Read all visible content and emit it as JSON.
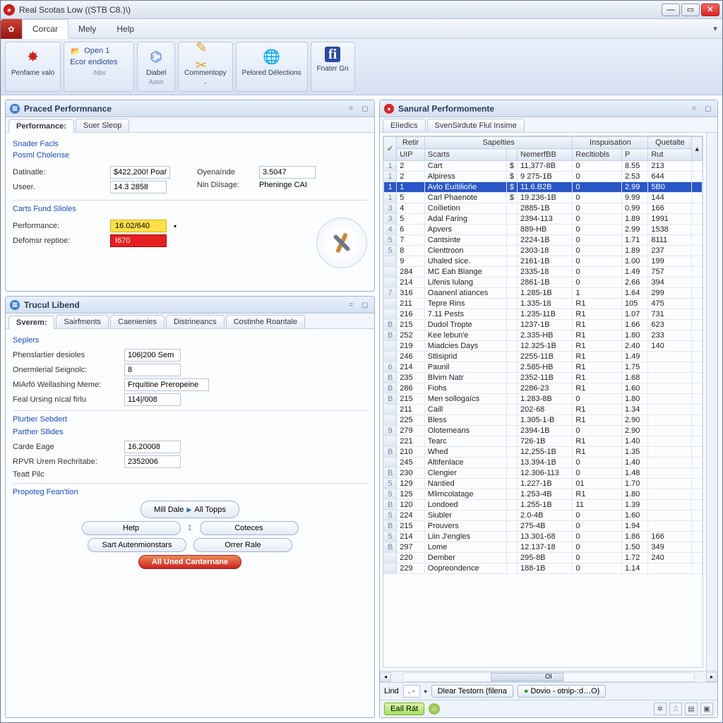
{
  "window": {
    "title": "Real Scotas Low ((STB C8.)\\)"
  },
  "menu": {
    "tabs": [
      "Corcar",
      "Mely",
      "Help"
    ],
    "active": 0
  },
  "ribbon": {
    "penfame": "Penfame valo",
    "open": {
      "open1": "Open 1",
      "endiotes": "Ecor endiotes",
      "nbs": "⁝Nbs"
    },
    "diabel": {
      "label": "Diabel",
      "sub": "Aoon"
    },
    "commentopy": {
      "label": "Commentopy",
      "sub": ""
    },
    "pelored": {
      "label": "Pelored Délections"
    },
    "fnater": {
      "label": "Fnater Gn"
    }
  },
  "panel1": {
    "title": "Praced Performnance",
    "tabs": [
      "Performance:",
      "Suer Sleop"
    ],
    "snader": "Snader Facls",
    "posml": "Posml Cholense",
    "datinatle_lbl": "Datinatle:",
    "datinatle_val": "$422,200! Poaŕ",
    "oyenaide_lbl": "Oyenaínde",
    "oyenaide_val": "3.5047",
    "useer_lbl": "Useer.",
    "useer_val": "14.3 2858",
    "ndisage_lbl": "Nin Diísage:",
    "ndisage_val": "Pheninge CAI",
    "carts": "Carts Fund Slioles",
    "perf_lbl": "Performance:",
    "perf_val": "16.02/640",
    "def_lbl": "Defomsr reptioe:",
    "def_val": "I670"
  },
  "panel2": {
    "title": "Trucul Libend",
    "tabs": [
      "Sverem:",
      "Sairfments",
      "Caenienies",
      "Distrineancs",
      "Costinhe Roantale"
    ],
    "seplers": "Seplers",
    "row1_lbl": "Phenslartier desioles",
    "row1_val": "106|200 Sem",
    "row2_lbl": "Onermlerial Seignolc:",
    "row2_val": "8",
    "row3_lbl": "MiArfó Wellashing Meme:",
    "row3_val": "Frquítine Preropeine",
    "row4_lbl": "Feal Ursing nícal fírlu",
    "row4_val": "114|/008",
    "plurber": "Plurber Sebdert",
    "partner": "Parther Sllides",
    "carde_lbl": "Carde Eage",
    "carde_val": "16,20008",
    "rpvr_lbl": "RPVR Urem Rechritabe:",
    "rpvr_val": "2352006",
    "teatt": "Teatt Pilc",
    "propoteg": "Propoteg Fean'tion",
    "btn_milldate": "Mill Dale",
    "btn_alltops": "All Topps",
    "btn_help": "Hetp",
    "btn_coteces": "Coteces",
    "btn_sart": "Sart Autenmionstars",
    "btn_orrer": "Orrer Rale",
    "btn_all": "All Uned Canternane"
  },
  "panel3": {
    "title": "Sanural Performomente",
    "tabs": [
      "Elíedics",
      "SvenSirdute Flul Insime"
    ],
    "header_super": [
      "Retir",
      "Sapelties",
      "Inspuisation",
      "Quetalte"
    ],
    "header": [
      "UIP",
      "Scarts",
      "NemerfBB",
      "Recltiobls",
      "P",
      "Rut"
    ],
    "rows": [
      {
        "n": "1",
        "u": "2",
        "s": "Cart",
        "d": "$",
        "nb": "11,377-8B",
        "r": "0",
        "p": "8.55",
        "rt": "213"
      },
      {
        "n": "1",
        "u": "2",
        "s": "Alpiress",
        "d": "$",
        "nb": "9 275-1B",
        "r": "0",
        "p": "2.53",
        "rt": "644"
      },
      {
        "n": "1",
        "u": "1",
        "s": "Avlo Euítilioňe",
        "d": "$",
        "nb": "11.6.B2B",
        "r": "0",
        "p": "2.99",
        "rt": "5B0",
        "sel": true
      },
      {
        "n": "1",
        "u": "5",
        "s": "Carl Phaenote",
        "d": "$",
        "nb": "19.236-1B",
        "r": "0",
        "p": "9.99",
        "rt": "144"
      },
      {
        "n": "3",
        "u": "4",
        "s": "Coílietion",
        "d": "",
        "nb": "2885-1B",
        "r": "0",
        "p": "0.99",
        "rt": "166"
      },
      {
        "n": "3",
        "u": "5",
        "s": "Adal Faring",
        "d": "",
        "nb": "2394-113",
        "r": "0",
        "p": "1.89",
        "rt": "1991"
      },
      {
        "n": "4",
        "u": "6",
        "s": "Apvers",
        "d": "",
        "nb": "889-HB",
        "r": "0",
        "p": "2.99",
        "rt": "1538"
      },
      {
        "n": "5",
        "u": "7",
        "s": "Cantsinte",
        "d": "",
        "nb": "2224-1B",
        "r": "0",
        "p": "1.71",
        "rt": "8111"
      },
      {
        "n": "5",
        "u": "8",
        "s": "Clenttroon",
        "d": "",
        "nb": "2303-18",
        "r": "0",
        "p": "1.89",
        "rt": "237"
      },
      {
        "n": "",
        "u": "9",
        "s": "Uhaled sice.",
        "d": "",
        "nb": "2161-1B",
        "r": "0",
        "p": "1.00",
        "rt": "199"
      },
      {
        "n": "",
        "u": "284",
        "s": "MC Eah Blange",
        "d": "",
        "nb": "2335-18",
        "r": "0",
        "p": "1.49",
        "rt": "757"
      },
      {
        "n": "",
        "u": "214",
        "s": "Lifenis lulang",
        "d": "",
        "nb": "2861-1B",
        "r": "0",
        "p": "2.66",
        "rt": "394"
      },
      {
        "n": "7",
        "u": "316",
        "s": "Oaanenl atiances",
        "d": "",
        "nb": "1.285-1B",
        "r": "1",
        "p": "1.64",
        "rt": "299"
      },
      {
        "n": "",
        "u": "211",
        "s": "Tepre Rins",
        "d": "",
        "nb": "1.335-18",
        "r": "R1",
        "p": "105",
        "rt": "475"
      },
      {
        "n": "",
        "u": "216",
        "s": "7.11 Pests",
        "d": "",
        "nb": "1.235-11B",
        "r": "R1",
        "p": "1.07",
        "rt": "731"
      },
      {
        "n": "B",
        "u": "215",
        "s": "Dudol Tropte",
        "d": "",
        "nb": "1237-1B",
        "r": "R1",
        "p": "1.66",
        "rt": "623"
      },
      {
        "n": "B",
        "u": "252",
        "s": "Kee lebun'e",
        "d": "",
        "nb": "2.335-HB",
        "r": "R1",
        "p": "1.80",
        "rt": "233"
      },
      {
        "n": "",
        "u": "219",
        "s": "Miadcies Days",
        "d": "",
        "nb": "12.325-1B",
        "r": "R1",
        "p": "2.40",
        "rt": "140"
      },
      {
        "n": "",
        "u": "246",
        "s": "Stlisiprid",
        "d": "",
        "nb": "2255-11B",
        "r": "R1",
        "p": "1.49",
        "rt": ""
      },
      {
        "n": "6",
        "u": "214",
        "s": "Paunil",
        "d": "",
        "nb": "2.585-HB",
        "r": "R1",
        "p": "1.75",
        "rt": ""
      },
      {
        "n": "B",
        "u": "235",
        "s": "Blvim Natr",
        "d": "",
        "nb": "2352-11B",
        "r": "R1",
        "p": "1.68",
        "rt": ""
      },
      {
        "n": "B",
        "u": "286",
        "s": "Fiohs",
        "d": "",
        "nb": "2286-23",
        "r": "R1",
        "p": "1.60",
        "rt": ""
      },
      {
        "n": "B",
        "u": "215",
        "s": "Men sollogaícs",
        "d": "",
        "nb": "1.283-8B",
        "r": "0",
        "p": "1.80",
        "rt": ""
      },
      {
        "n": "",
        "u": "211",
        "s": "Caill",
        "d": "",
        "nb": "202-68",
        "r": "R1",
        "p": "1.34",
        "rt": ""
      },
      {
        "n": "",
        "u": "225",
        "s": "Bless",
        "d": "",
        "nb": "1.305-1-B",
        "r": "R1",
        "p": "2.90",
        "rt": ""
      },
      {
        "n": "9",
        "u": "279",
        "s": "Olotemeans",
        "d": "",
        "nb": "2394-1B",
        "r": "0",
        "p": "2.90",
        "rt": ""
      },
      {
        "n": "",
        "u": "221",
        "s": "Tearc",
        "d": "",
        "nb": "726-1B",
        "r": "R1",
        "p": "1.40",
        "rt": ""
      },
      {
        "n": "B",
        "u": "210",
        "s": "Whed",
        "d": "",
        "nb": "12,255-1B",
        "r": "R1",
        "p": "1.35",
        "rt": ""
      },
      {
        "n": "",
        "u": "245",
        "s": "Altifenlace",
        "d": "",
        "nb": "13.394-1B",
        "r": "0",
        "p": "1.40",
        "rt": ""
      },
      {
        "n": "B",
        "u": "230",
        "s": "Clengier",
        "d": "",
        "nb": "12.306-113",
        "r": "0",
        "p": "1.48",
        "rt": ""
      },
      {
        "n": "5",
        "u": "129",
        "s": "Nantied",
        "d": "",
        "nb": "1.227-1B",
        "r": "01",
        "p": "1.70",
        "rt": ""
      },
      {
        "n": "5",
        "u": "125",
        "s": "Mlimcolatage",
        "d": "",
        "nb": "1.253-4B",
        "r": "R1",
        "p": "1.80",
        "rt": ""
      },
      {
        "n": "B",
        "u": "120",
        "s": "Londoed",
        "d": "",
        "nb": "1.255-1B",
        "r": "11",
        "p": "1.39",
        "rt": ""
      },
      {
        "n": "5",
        "u": "224",
        "s": "Siubler",
        "d": "",
        "nb": "2.0-4B",
        "r": "0",
        "p": "1.60",
        "rt": ""
      },
      {
        "n": "B",
        "u": "215",
        "s": "Prouvers",
        "d": "",
        "nb": "275-4B",
        "r": "0",
        "p": "1.94",
        "rt": ""
      },
      {
        "n": "5",
        "u": "214",
        "s": "Liin J'engles",
        "d": "",
        "nb": "13.301-68",
        "r": "0",
        "p": "1.86",
        "rt": "166"
      },
      {
        "n": "B",
        "u": "297",
        "s": "Lome",
        "d": "",
        "nb": "12.137-18",
        "r": "0",
        "p": "1.50",
        "rt": "349"
      },
      {
        "n": "",
        "u": "220",
        "s": "Dember",
        "d": "",
        "nb": "295-8B",
        "r": "0",
        "p": "1.72",
        "rt": "240"
      },
      {
        "n": "",
        "u": "229",
        "s": "Oopreondence",
        "d": "",
        "nb": "188-1B",
        "r": "0",
        "p": "1.14",
        "rt": ""
      }
    ],
    "scroll_label": "OI"
  },
  "footer": {
    "lind": "Lind",
    "lind_val": ". -",
    "dlear": "Dlear Testorn (filena",
    "dovio": "Dovio - otnip-:d…O)",
    "eail": "Eaíl Rát"
  }
}
